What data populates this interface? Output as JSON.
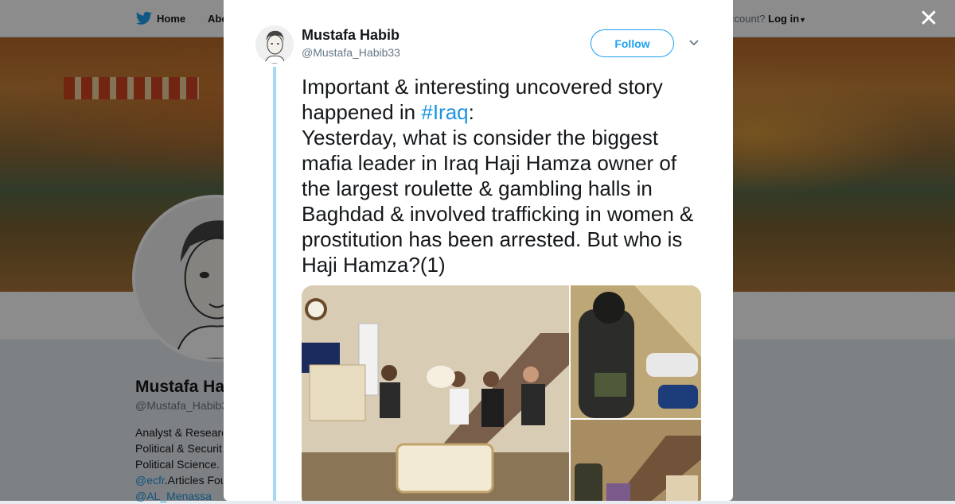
{
  "background": {
    "nav": {
      "home": "Home",
      "about": "Abo",
      "login_prefix": "ccount?",
      "login": "Log in"
    },
    "profile": {
      "name": "Mustafa Ha",
      "handle": "@Mustafa_Habib3",
      "bio_lines": [
        "Analyst & Researc",
        "Political & Securit",
        "Political Science. "
      ],
      "mention_1": "@ecfr",
      "mention_1_tail": ".Articles Fou",
      "mention_2": "@AL_Menassa"
    }
  },
  "modal": {
    "author_name": "Mustafa Habib",
    "author_handle": "@Mustafa_Habib33",
    "follow_label": "Follow",
    "tweet": {
      "part1": "Important & interesting uncovered story happened in ",
      "hashtag": "#Iraq",
      "part2": ":\nYesterday, what is consider the biggest mafia leader in Iraq Haji Hamza owner of the largest roulette & gambling halls in Baghdad & involved trafficking in women & prostitution has been arrested. But who is Haji Hamza?(1)"
    }
  },
  "colors": {
    "accent": "#1da1f2",
    "link": "#1b95e0",
    "thread_line": "#a8d6f5"
  }
}
